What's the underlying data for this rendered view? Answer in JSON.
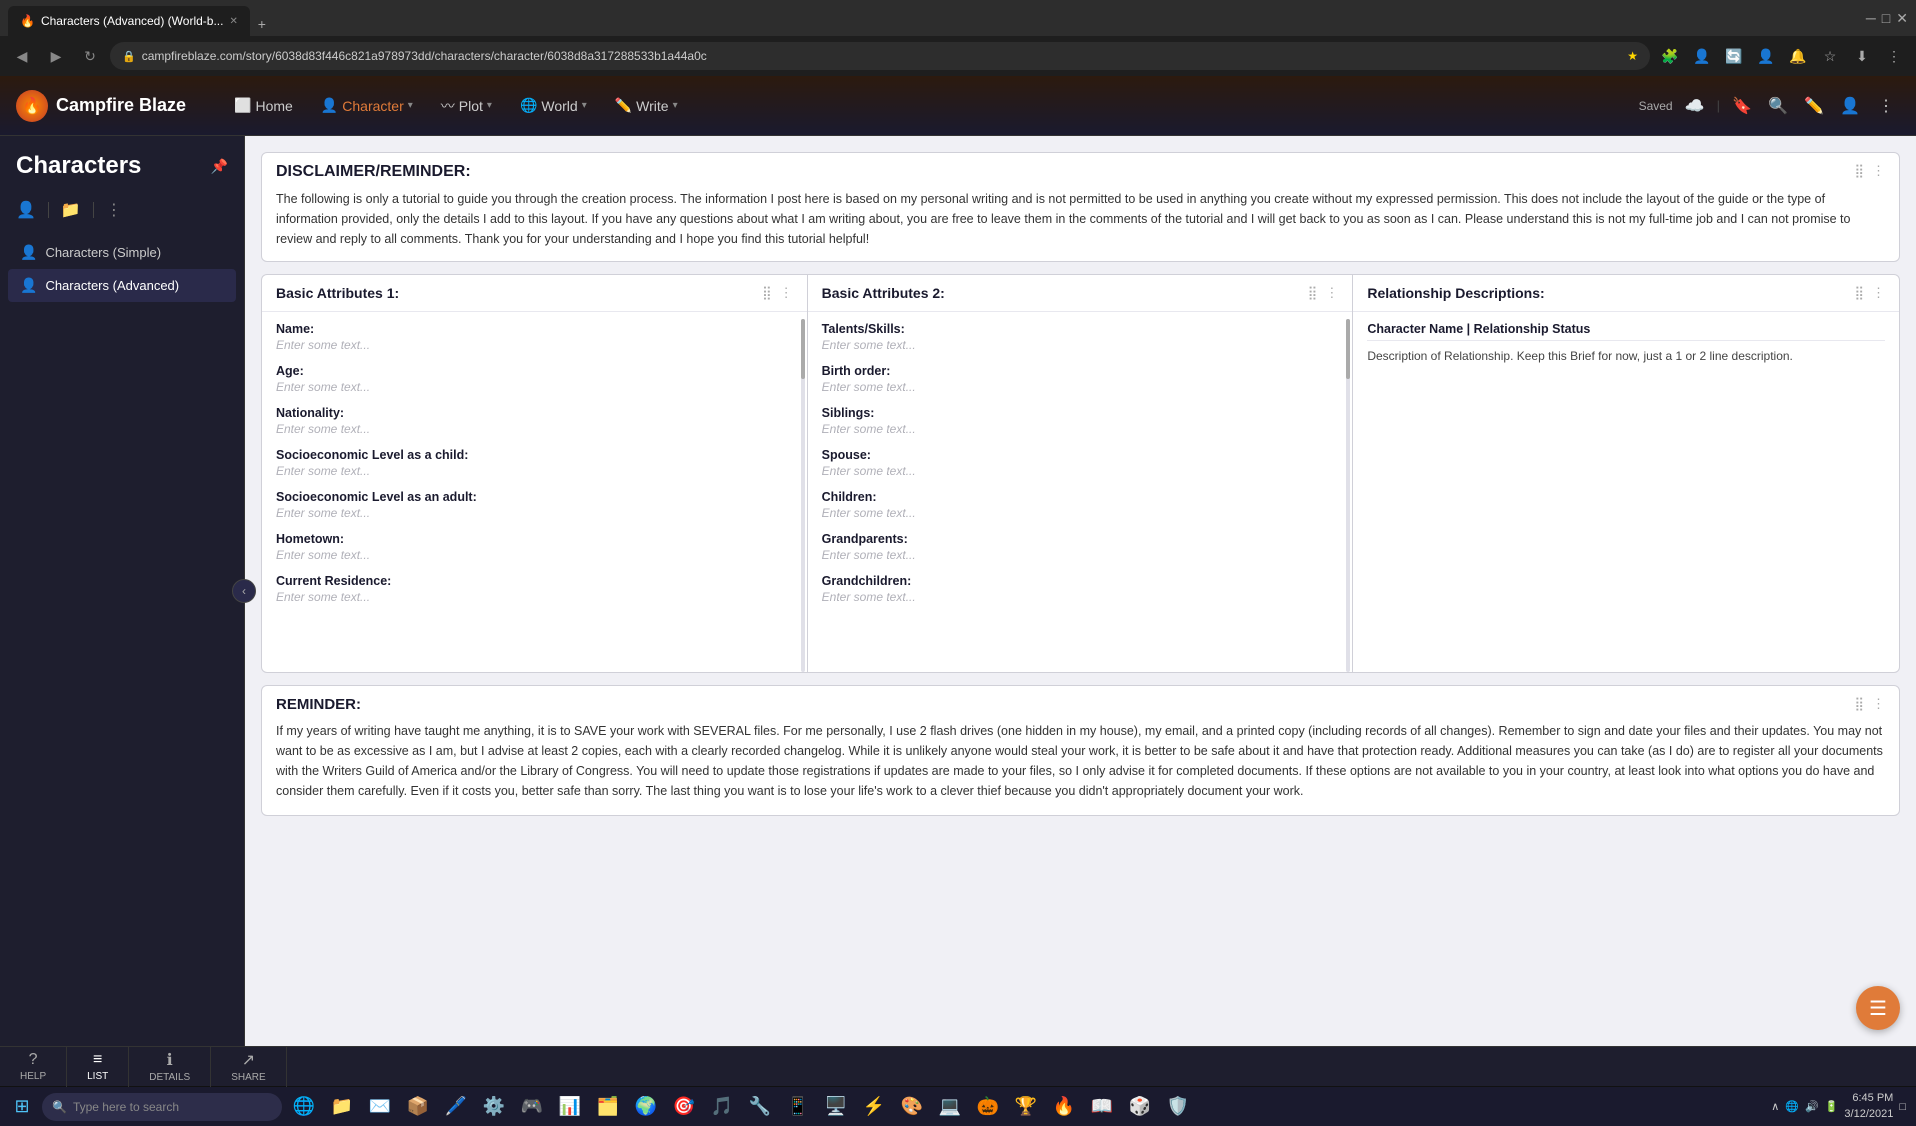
{
  "browser": {
    "tabs": [
      {
        "label": "Characters (Advanced) (World-b...",
        "active": true,
        "favicon": "🔥"
      },
      {
        "label": "+",
        "active": false
      }
    ],
    "url": "campfireblaze.com/story/6038d83f446c821a978973dd/characters/character/6038d8a317288533b1a44a0c",
    "nav_back": "◀",
    "nav_forward": "▶",
    "nav_refresh": "↻"
  },
  "app": {
    "logo": "🔥",
    "name": "Campfire Blaze",
    "nav": [
      {
        "id": "home",
        "label": "Home",
        "icon": "⬜"
      },
      {
        "id": "character",
        "label": "Character",
        "icon": "👤",
        "active": true,
        "has_arrow": true
      },
      {
        "id": "plot",
        "label": "Plot",
        "icon": "〰️",
        "has_arrow": true
      },
      {
        "id": "world",
        "label": "World",
        "icon": "🌐",
        "has_arrow": true
      },
      {
        "id": "write",
        "label": "Write",
        "icon": "✏️",
        "has_arrow": true
      }
    ],
    "header_right": {
      "saved": "Saved",
      "icons": [
        "☁️",
        "|",
        "🔖",
        "🔍",
        "✏️",
        "👤",
        "⋮"
      ]
    }
  },
  "sidebar": {
    "title": "Characters",
    "items": [
      {
        "id": "simple",
        "label": "Characters (Simple)",
        "icon": "👤"
      },
      {
        "id": "advanced",
        "label": "Characters (Advanced)",
        "icon": "👤",
        "active": true
      }
    ]
  },
  "disclaimer": {
    "title": "DISCLAIMER/REMINDER:",
    "body": "The following is only a tutorial to guide you through the creation process. The information I post here is based on my personal writing and is not permitted to be used in anything you create without my expressed permission. This does not include the layout of the guide or the type of information provided, only the details I add to this layout. If you have any questions about what I am writing about, you are free to leave them in the comments of the tutorial and I will get back to you as soon as I can. Please understand this is not my full-time job and I can not promise to review and reply to all comments. Thank you for your understanding and I hope you find this tutorial helpful!"
  },
  "panels": {
    "col1": {
      "title": "Basic Attributes 1:",
      "fields": [
        {
          "label": "Name:",
          "placeholder": "Enter some text..."
        },
        {
          "label": "Age:",
          "placeholder": "Enter some text..."
        },
        {
          "label": "Nationality:",
          "placeholder": "Enter some text..."
        },
        {
          "label": "Socioeconomic Level as a child:",
          "placeholder": "Enter some text..."
        },
        {
          "label": "Socioeconomic Level as an adult:",
          "placeholder": "Enter some text..."
        },
        {
          "label": "Hometown:",
          "placeholder": "Enter some text..."
        },
        {
          "label": "Current Residence:",
          "placeholder": "Enter some text..."
        }
      ]
    },
    "col2": {
      "title": "Basic Attributes 2:",
      "fields": [
        {
          "label": "Talents/Skills:",
          "placeholder": "Enter some text..."
        },
        {
          "label": "Birth order:",
          "placeholder": "Enter some text..."
        },
        {
          "label": "Siblings:",
          "placeholder": "Enter some text..."
        },
        {
          "label": "Spouse:",
          "placeholder": "Enter some text..."
        },
        {
          "label": "Children:",
          "placeholder": "Enter some text..."
        },
        {
          "label": "Grandparents:",
          "placeholder": "Enter some text..."
        },
        {
          "label": "Grandchildren:",
          "placeholder": "Enter some text..."
        }
      ]
    },
    "col3": {
      "title": "Relationship Descriptions:",
      "header_row": "Character Name | Relationship Status",
      "desc_row": "Description of Relationship. Keep this Brief for now, just a 1 or 2 line description."
    }
  },
  "reminder": {
    "title": "REMINDER:",
    "body": "If my years of writing have taught me anything, it is to SAVE your work with SEVERAL files. For me personally, I use 2 flash drives (one hidden in my house), my email, and a printed copy (including records of all changes). Remember to sign and date your files and their updates. You may not want to be as excessive as I am, but I advise at least 2 copies, each with a clearly recorded changelog. While it is unlikely anyone would steal your work, it is better to be safe about it and have that protection ready. Additional measures you can take (as I do) are to register all your documents with the Writers Guild of America and/or the Library of Congress. You will need to update those registrations if updates are made to your files, so I only advise it for completed documents. If these options are not available to you in your country, at least look into what options you do have and consider them carefully. Even if it costs you, better safe than sorry. The last thing you want is to lose your life's work to a clever thief because you didn't appropriately document your work."
  },
  "bottom_toolbar": {
    "buttons": [
      {
        "id": "help",
        "icon": "?",
        "label": "HELP"
      },
      {
        "id": "list",
        "icon": "≡",
        "label": "LIST",
        "active": true
      },
      {
        "id": "details",
        "icon": "ℹ",
        "label": "DETAILS"
      },
      {
        "id": "share",
        "icon": "↗",
        "label": "SHARE"
      }
    ]
  },
  "taskbar": {
    "search_placeholder": "Type here to search",
    "time": "6:45 PM",
    "date": "3/12/2021",
    "apps": [
      "🌐",
      "📁",
      "✉️",
      "📦",
      "🖊️",
      "⚙️",
      "🎮",
      "📊",
      "🗂️",
      "🌍",
      "🎯",
      "🎵",
      "🔧",
      "📱",
      "🖥️",
      "⚡",
      "🎨",
      "💻",
      "🎃",
      "🏆",
      "🔥",
      "📖",
      "🎲",
      "🛡️",
      "🖥️"
    ]
  },
  "floating_btn": {
    "icon": "☰",
    "color": "#e07b39"
  }
}
